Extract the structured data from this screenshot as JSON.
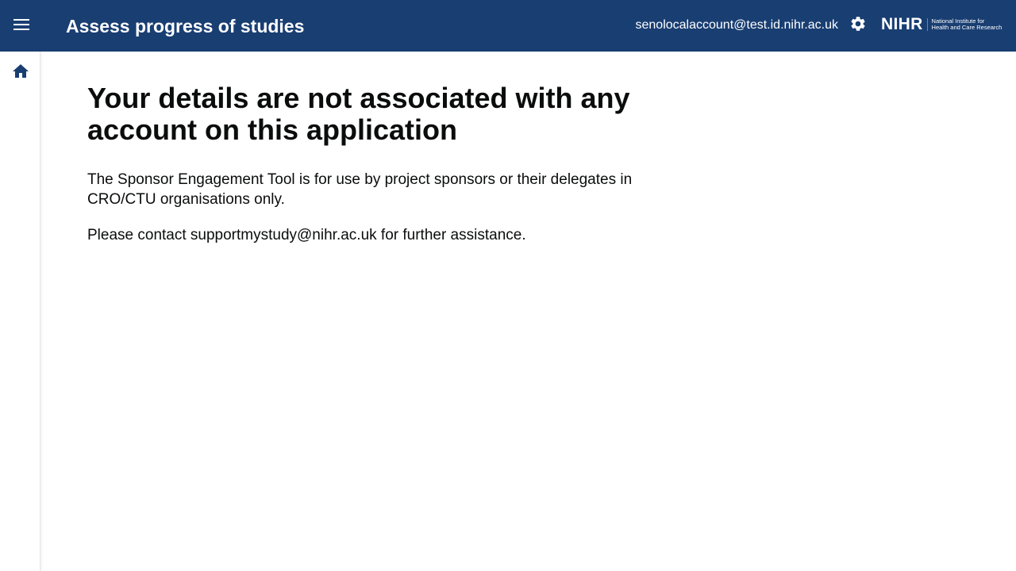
{
  "header": {
    "menu_icon": "hamburger-menu-icon",
    "app_title": "Assess progress of studies",
    "user_email": "senolocalaccount@test.id.nihr.ac.uk",
    "settings_icon": "gear-icon",
    "logo": {
      "mark": "NIHR",
      "line1": "National Institute for",
      "line2": "Health and Care Research"
    },
    "background_color": "#193e72"
  },
  "sidebar": {
    "home_icon": "home-icon",
    "icon_color": "#193e72"
  },
  "main": {
    "heading": "Your details are not associated with any account on this application",
    "paragraph1": "The Sponsor Engagement Tool is for use by project sponsors or their delegates in CRO/CTU organisations only.",
    "paragraph2": "Please contact supportmystudy@nihr.ac.uk for further assistance."
  }
}
